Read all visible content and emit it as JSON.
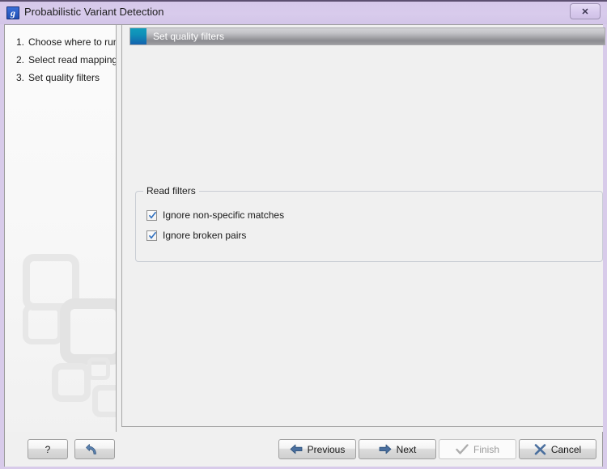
{
  "window": {
    "title": "Probabilistic Variant Detection",
    "app_icon": "application-g-icon",
    "close_label": "✕",
    "accent_title_bar": "#d8cbea",
    "accent_header_icon": "#1172b5"
  },
  "sidebar": {
    "steps": [
      {
        "num": "1.",
        "label": "Choose where to run"
      },
      {
        "num": "2.",
        "label": "Select read mappings"
      },
      {
        "num": "3.",
        "label": "Set quality filters"
      }
    ]
  },
  "panel": {
    "header_title": "Set quality filters",
    "header_icon": "step-square-icon"
  },
  "read_filters": {
    "group_title": "Read filters",
    "options": [
      {
        "label": "Ignore non-specific matches",
        "checked": true
      },
      {
        "label": "Ignore broken pairs",
        "checked": true
      }
    ]
  },
  "footer": {
    "help_label": "?",
    "reset_label": "",
    "previous_label": "Previous",
    "next_label": "Next",
    "finish_label": "Finish",
    "cancel_label": "Cancel"
  }
}
